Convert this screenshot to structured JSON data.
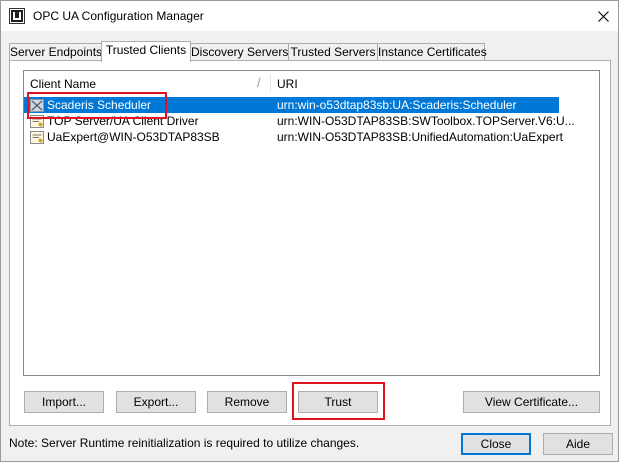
{
  "window": {
    "title": "OPC UA Configuration Manager"
  },
  "tabs": [
    {
      "label": "Server Endpoints",
      "active": false
    },
    {
      "label": "Trusted Clients",
      "active": true
    },
    {
      "label": "Discovery Servers",
      "active": false
    },
    {
      "label": "Trusted Servers",
      "active": false
    },
    {
      "label": "Instance Certificates",
      "active": false
    }
  ],
  "list": {
    "columns": [
      "Client Name",
      "URI"
    ],
    "rows": [
      {
        "name": "Scaderis Scheduler",
        "uri": "urn:win-o53dtap83sb:UA:Scaderis:Scheduler",
        "selected": true
      },
      {
        "name": "TOP Server/UA Client Driver",
        "uri": "urn:WIN-O53DTAP83SB:SWToolbox.TOPServer.V6:U...",
        "selected": false
      },
      {
        "name": "UaExpert@WIN-O53DTAP83SB",
        "uri": "urn:WIN-O53DTAP83SB:UnifiedAutomation:UaExpert",
        "selected": false
      }
    ]
  },
  "buttons": {
    "import": "Import...",
    "export": "Export...",
    "remove": "Remove",
    "trust": "Trust",
    "view_certificate": "View Certificate...",
    "close": "Close",
    "help": "Aide"
  },
  "footer": {
    "note": "Note: Server Runtime reinitialization is required to utilize changes."
  },
  "colors": {
    "selection": "#0078d7",
    "highlight": "#e0121d",
    "window_bg": "#f0f0f0"
  }
}
